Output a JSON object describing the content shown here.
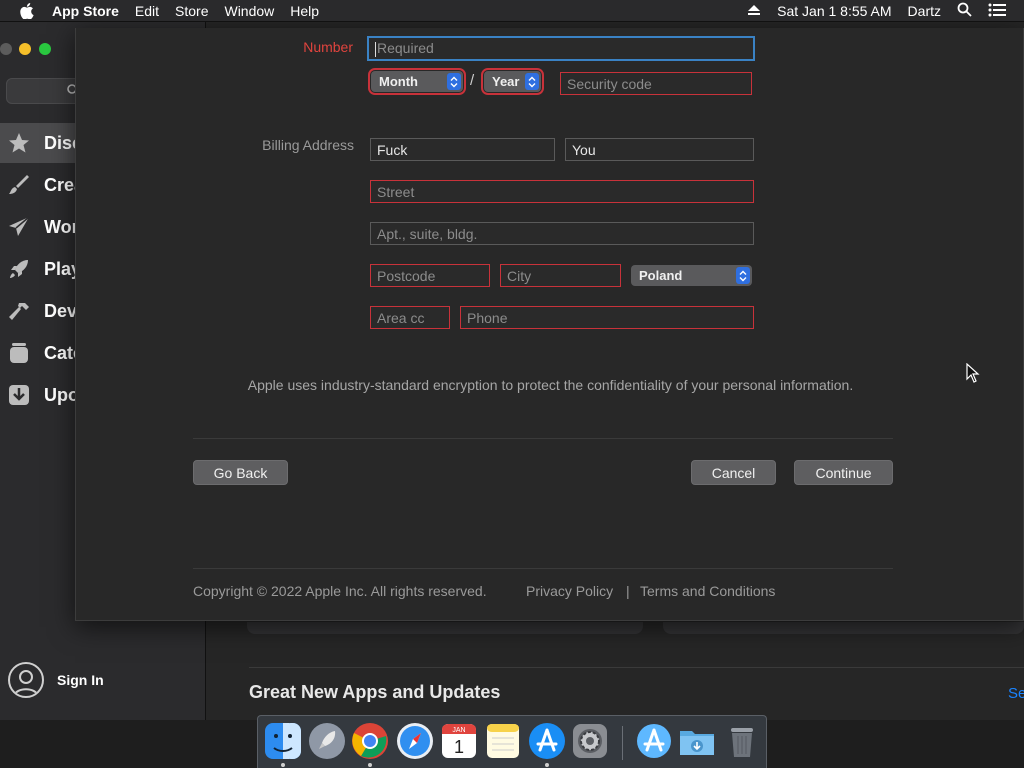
{
  "menubar": {
    "app_name": "App Store",
    "menus": [
      "Edit",
      "Store",
      "Window",
      "Help"
    ],
    "datetime": "Sat Jan 1  8:55 AM",
    "user": "Dartz"
  },
  "sidebar": {
    "items": [
      {
        "label": "Disc",
        "icon": "star-icon"
      },
      {
        "label": "Crea",
        "icon": "brush-icon"
      },
      {
        "label": "Wor",
        "icon": "paper-plane-icon"
      },
      {
        "label": "Play",
        "icon": "rocket-icon"
      },
      {
        "label": "Dev",
        "icon": "hammer-icon"
      },
      {
        "label": "Cate",
        "icon": "box-icon"
      },
      {
        "label": "Upo",
        "icon": "download-icon"
      }
    ],
    "signin_label": "Sign In"
  },
  "main": {
    "section_title": "Great New Apps and Updates",
    "see_all": "Se"
  },
  "form": {
    "number_label": "Number",
    "number_placeholder": "Required",
    "month": "Month",
    "year": "Year",
    "slash": "/",
    "security_placeholder": "Security code",
    "billing_label": "Billing Address",
    "first_name": "Fuck",
    "last_name": "You",
    "street_placeholder": "Street",
    "apt_placeholder": "Apt., suite, bldg.",
    "postcode_placeholder": "Postcode",
    "city_placeholder": "City",
    "country": "Poland",
    "area_placeholder": "Area cc",
    "phone_placeholder": "Phone",
    "info_text": "Apple uses industry-standard encryption to protect the confidentiality of your personal information."
  },
  "buttons": {
    "go_back": "Go Back",
    "cancel": "Cancel",
    "continue": "Continue"
  },
  "footer": {
    "copyright": "Copyright © 2022 Apple Inc. All rights reserved.",
    "privacy": "Privacy Policy",
    "separator": "|",
    "terms": "Terms and Conditions"
  },
  "dock": {
    "apps": [
      "finder-icon",
      "launchpad-icon",
      "chrome-icon",
      "safari-icon",
      "calendar-icon",
      "notes-icon",
      "app-store-icon",
      "system-preferences-icon",
      "applications-folder-icon",
      "downloads-folder-icon",
      "trash-icon"
    ],
    "calendar_month": "JAN",
    "calendar_day": "1"
  },
  "colors": {
    "error": "#c8323a",
    "focus": "#3a82c4",
    "accent": "#2f6fe0",
    "link": "#1a84ff"
  }
}
